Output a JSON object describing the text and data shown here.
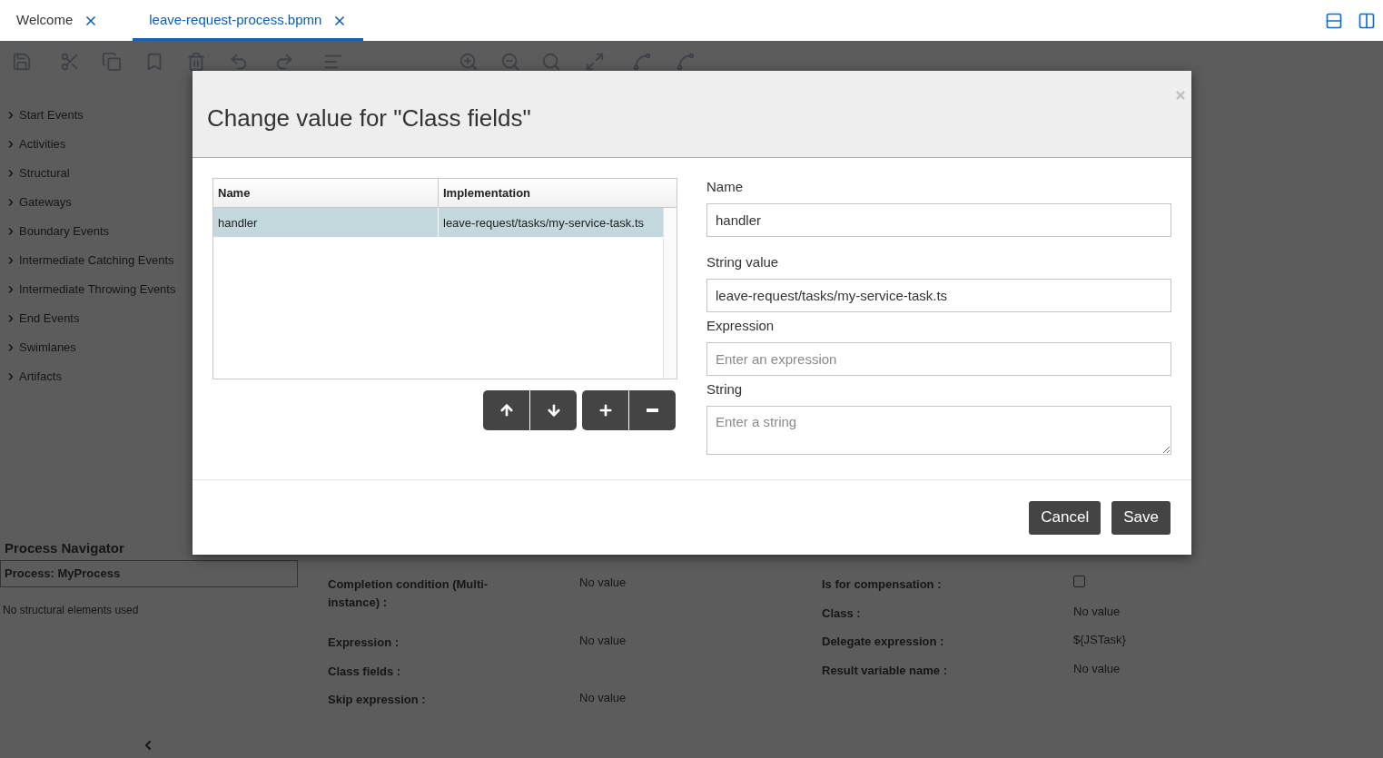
{
  "tabs": [
    {
      "label": "Welcome",
      "selected": false
    },
    {
      "label": "leave-request-process.bpmn",
      "selected": true
    }
  ],
  "palette": {
    "items": [
      {
        "label": "Start Events"
      },
      {
        "label": "Activities"
      },
      {
        "label": "Structural"
      },
      {
        "label": "Gateways"
      },
      {
        "label": "Boundary Events"
      },
      {
        "label": "Intermediate Catching Events"
      },
      {
        "label": "Intermediate Throwing Events"
      },
      {
        "label": "End Events"
      },
      {
        "label": "Swimlanes"
      },
      {
        "label": "Artifacts"
      }
    ]
  },
  "navigator": {
    "title": "Process Navigator",
    "process": "Process: MyProcess",
    "empty_text": "No structural elements used"
  },
  "properties": {
    "left": [
      {
        "label": "Completion condition (Multi-instance) :",
        "value": "No value"
      },
      {
        "label": "Expression :",
        "value": "No value"
      },
      {
        "label": "Class fields :"
      },
      {
        "label": "Skip expression :",
        "value": "No value"
      }
    ],
    "right": [
      {
        "label": "Is for compensation :",
        "kind": "checkbox",
        "checked": false
      },
      {
        "label": "Class :",
        "kind": "text",
        "value": "No value"
      },
      {
        "label": "Delegate expression :",
        "kind": "text",
        "value": "${JSTask}"
      },
      {
        "label": "Result variable name :",
        "kind": "text",
        "value": "No value"
      }
    ]
  },
  "dialog": {
    "title": "Change value for \"Class fields\"",
    "table": {
      "columns": [
        "Name",
        "Implementation"
      ],
      "rows": [
        {
          "name": "handler",
          "implementation": "leave-request/tasks/my-service-task.ts",
          "selected": true
        }
      ]
    },
    "fields": [
      {
        "label": "Name",
        "kind": "input",
        "value": "handler"
      },
      {
        "label": "String value",
        "kind": "input",
        "value": "leave-request/tasks/my-service-task.ts"
      },
      {
        "label": "Expression",
        "kind": "input",
        "placeholder": "Enter an expression"
      },
      {
        "label": "String",
        "kind": "textarea",
        "placeholder": "Enter a string"
      }
    ],
    "buttons": [
      "Cancel",
      "Save"
    ]
  }
}
